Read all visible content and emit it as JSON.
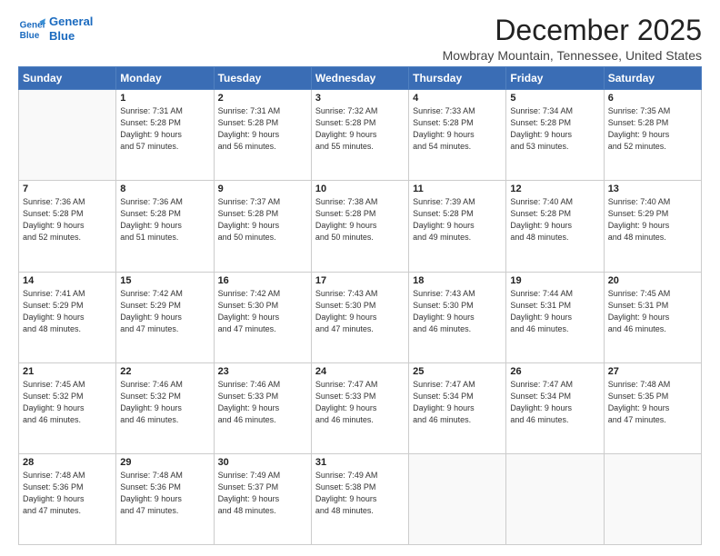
{
  "logo": {
    "line1": "General",
    "line2": "Blue"
  },
  "title": "December 2025",
  "subtitle": "Mowbray Mountain, Tennessee, United States",
  "days_of_week": [
    "Sunday",
    "Monday",
    "Tuesday",
    "Wednesday",
    "Thursday",
    "Friday",
    "Saturday"
  ],
  "weeks": [
    [
      {
        "day": "",
        "info": ""
      },
      {
        "day": "1",
        "info": "Sunrise: 7:31 AM\nSunset: 5:28 PM\nDaylight: 9 hours\nand 57 minutes."
      },
      {
        "day": "2",
        "info": "Sunrise: 7:31 AM\nSunset: 5:28 PM\nDaylight: 9 hours\nand 56 minutes."
      },
      {
        "day": "3",
        "info": "Sunrise: 7:32 AM\nSunset: 5:28 PM\nDaylight: 9 hours\nand 55 minutes."
      },
      {
        "day": "4",
        "info": "Sunrise: 7:33 AM\nSunset: 5:28 PM\nDaylight: 9 hours\nand 54 minutes."
      },
      {
        "day": "5",
        "info": "Sunrise: 7:34 AM\nSunset: 5:28 PM\nDaylight: 9 hours\nand 53 minutes."
      },
      {
        "day": "6",
        "info": "Sunrise: 7:35 AM\nSunset: 5:28 PM\nDaylight: 9 hours\nand 52 minutes."
      }
    ],
    [
      {
        "day": "7",
        "info": "Sunrise: 7:36 AM\nSunset: 5:28 PM\nDaylight: 9 hours\nand 52 minutes."
      },
      {
        "day": "8",
        "info": "Sunrise: 7:36 AM\nSunset: 5:28 PM\nDaylight: 9 hours\nand 51 minutes."
      },
      {
        "day": "9",
        "info": "Sunrise: 7:37 AM\nSunset: 5:28 PM\nDaylight: 9 hours\nand 50 minutes."
      },
      {
        "day": "10",
        "info": "Sunrise: 7:38 AM\nSunset: 5:28 PM\nDaylight: 9 hours\nand 50 minutes."
      },
      {
        "day": "11",
        "info": "Sunrise: 7:39 AM\nSunset: 5:28 PM\nDaylight: 9 hours\nand 49 minutes."
      },
      {
        "day": "12",
        "info": "Sunrise: 7:40 AM\nSunset: 5:28 PM\nDaylight: 9 hours\nand 48 minutes."
      },
      {
        "day": "13",
        "info": "Sunrise: 7:40 AM\nSunset: 5:29 PM\nDaylight: 9 hours\nand 48 minutes."
      }
    ],
    [
      {
        "day": "14",
        "info": "Sunrise: 7:41 AM\nSunset: 5:29 PM\nDaylight: 9 hours\nand 48 minutes."
      },
      {
        "day": "15",
        "info": "Sunrise: 7:42 AM\nSunset: 5:29 PM\nDaylight: 9 hours\nand 47 minutes."
      },
      {
        "day": "16",
        "info": "Sunrise: 7:42 AM\nSunset: 5:30 PM\nDaylight: 9 hours\nand 47 minutes."
      },
      {
        "day": "17",
        "info": "Sunrise: 7:43 AM\nSunset: 5:30 PM\nDaylight: 9 hours\nand 47 minutes."
      },
      {
        "day": "18",
        "info": "Sunrise: 7:43 AM\nSunset: 5:30 PM\nDaylight: 9 hours\nand 46 minutes."
      },
      {
        "day": "19",
        "info": "Sunrise: 7:44 AM\nSunset: 5:31 PM\nDaylight: 9 hours\nand 46 minutes."
      },
      {
        "day": "20",
        "info": "Sunrise: 7:45 AM\nSunset: 5:31 PM\nDaylight: 9 hours\nand 46 minutes."
      }
    ],
    [
      {
        "day": "21",
        "info": "Sunrise: 7:45 AM\nSunset: 5:32 PM\nDaylight: 9 hours\nand 46 minutes."
      },
      {
        "day": "22",
        "info": "Sunrise: 7:46 AM\nSunset: 5:32 PM\nDaylight: 9 hours\nand 46 minutes."
      },
      {
        "day": "23",
        "info": "Sunrise: 7:46 AM\nSunset: 5:33 PM\nDaylight: 9 hours\nand 46 minutes."
      },
      {
        "day": "24",
        "info": "Sunrise: 7:47 AM\nSunset: 5:33 PM\nDaylight: 9 hours\nand 46 minutes."
      },
      {
        "day": "25",
        "info": "Sunrise: 7:47 AM\nSunset: 5:34 PM\nDaylight: 9 hours\nand 46 minutes."
      },
      {
        "day": "26",
        "info": "Sunrise: 7:47 AM\nSunset: 5:34 PM\nDaylight: 9 hours\nand 46 minutes."
      },
      {
        "day": "27",
        "info": "Sunrise: 7:48 AM\nSunset: 5:35 PM\nDaylight: 9 hours\nand 47 minutes."
      }
    ],
    [
      {
        "day": "28",
        "info": "Sunrise: 7:48 AM\nSunset: 5:36 PM\nDaylight: 9 hours\nand 47 minutes."
      },
      {
        "day": "29",
        "info": "Sunrise: 7:48 AM\nSunset: 5:36 PM\nDaylight: 9 hours\nand 47 minutes."
      },
      {
        "day": "30",
        "info": "Sunrise: 7:49 AM\nSunset: 5:37 PM\nDaylight: 9 hours\nand 48 minutes."
      },
      {
        "day": "31",
        "info": "Sunrise: 7:49 AM\nSunset: 5:38 PM\nDaylight: 9 hours\nand 48 minutes."
      },
      {
        "day": "",
        "info": ""
      },
      {
        "day": "",
        "info": ""
      },
      {
        "day": "",
        "info": ""
      }
    ]
  ]
}
